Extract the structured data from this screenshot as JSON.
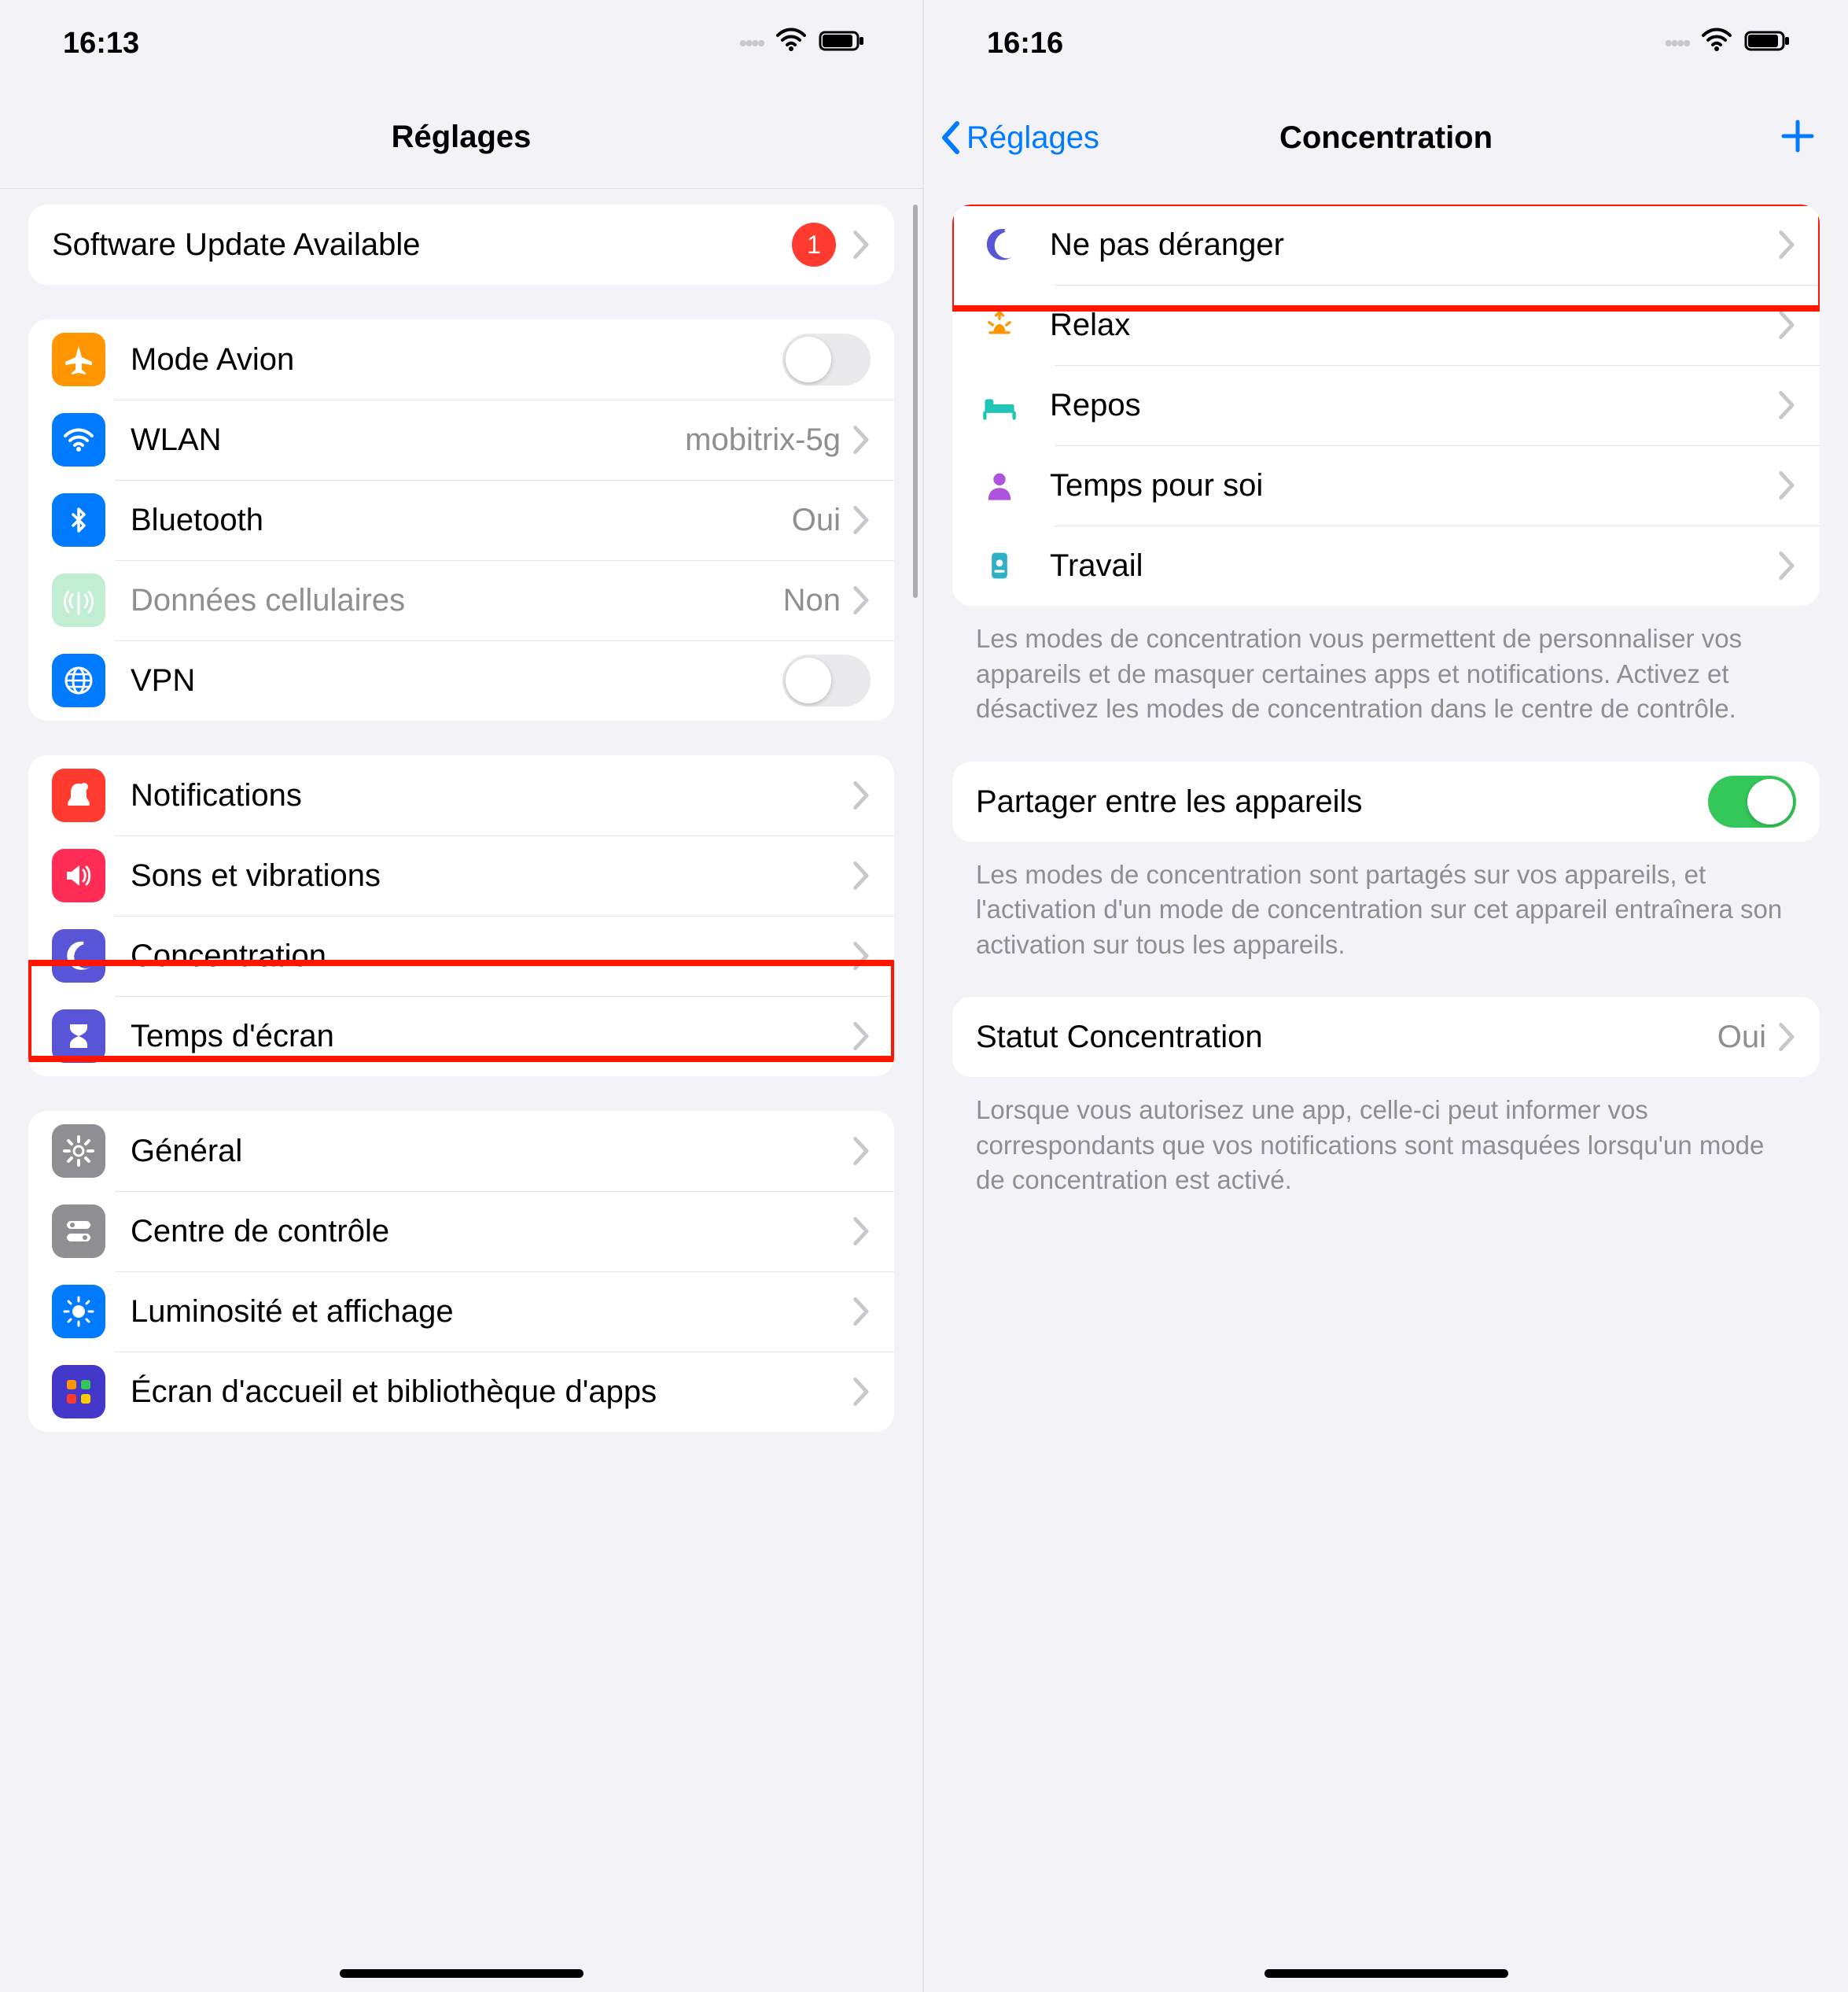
{
  "left": {
    "status_time": "16:13",
    "nav_title": "Réglages",
    "update": {
      "label": "Software Update Available",
      "badge": "1"
    },
    "connectivity": [
      {
        "label": "Mode Avion",
        "value": "",
        "toggle": "off",
        "icon": "airplane",
        "color": "#ff9500"
      },
      {
        "label": "WLAN",
        "value": "mobitrix-5g",
        "icon": "wifi",
        "color": "#007aff"
      },
      {
        "label": "Bluetooth",
        "value": "Oui",
        "icon": "bluetooth",
        "color": "#007aff"
      },
      {
        "label": "Données cellulaires",
        "value": "Non",
        "icon": "antenna",
        "color": "#8fe1b0",
        "dim": true
      },
      {
        "label": "VPN",
        "value": "",
        "toggle": "off",
        "icon": "globe",
        "color": "#007aff"
      }
    ],
    "notifications_group": [
      {
        "label": "Notifications",
        "icon": "bell",
        "color": "#ff3b30"
      },
      {
        "label": "Sons et vibrations",
        "icon": "speaker",
        "color": "#ff2d55"
      },
      {
        "label": "Concentration",
        "icon": "moon",
        "color": "#5856d6",
        "highlight": true
      },
      {
        "label": "Temps d'écran",
        "icon": "hourglass",
        "color": "#5856d6"
      }
    ],
    "general_group": [
      {
        "label": "Général",
        "icon": "gear",
        "color": "#8e8e93"
      },
      {
        "label": "Centre de contrôle",
        "icon": "switches",
        "color": "#8e8e93"
      },
      {
        "label": "Luminosité et affichage",
        "icon": "brightness",
        "color": "#007aff"
      },
      {
        "label": "Écran d'accueil et bibliothèque d'apps",
        "icon": "grid",
        "color": "#4f46e5"
      }
    ]
  },
  "right": {
    "status_time": "16:16",
    "back_label": "Réglages",
    "nav_title": "Concentration",
    "focus_modes": [
      {
        "label": "Ne pas déranger",
        "icon": "moon",
        "color": "#5856d6",
        "highlight": true
      },
      {
        "label": "Relax",
        "icon": "sunset",
        "color": "#ff9500"
      },
      {
        "label": "Repos",
        "icon": "bed",
        "color": "#20c5b5"
      },
      {
        "label": "Temps pour soi",
        "icon": "person",
        "color": "#af52de"
      },
      {
        "label": "Travail",
        "icon": "badge",
        "color": "#30b0c7"
      }
    ],
    "focus_footer": "Les modes de concentration vous permettent de personnaliser vos appareils et de masquer certaines apps et notifications. Activez et désactivez les modes de concentration dans le centre de contrôle.",
    "share": {
      "label": "Partager entre les appareils",
      "toggle": "on"
    },
    "share_footer": "Les modes de concentration sont partagés sur vos appareils, et l'activation d'un mode de concentration sur cet appareil entraînera son activation sur tous les appareils.",
    "status_row": {
      "label": "Statut Concentration",
      "value": "Oui"
    },
    "status_footer": "Lorsque vous autorisez une app, celle-ci peut informer vos correspondants que vos notifications sont masquées lorsqu'un mode de concentration est activé."
  }
}
